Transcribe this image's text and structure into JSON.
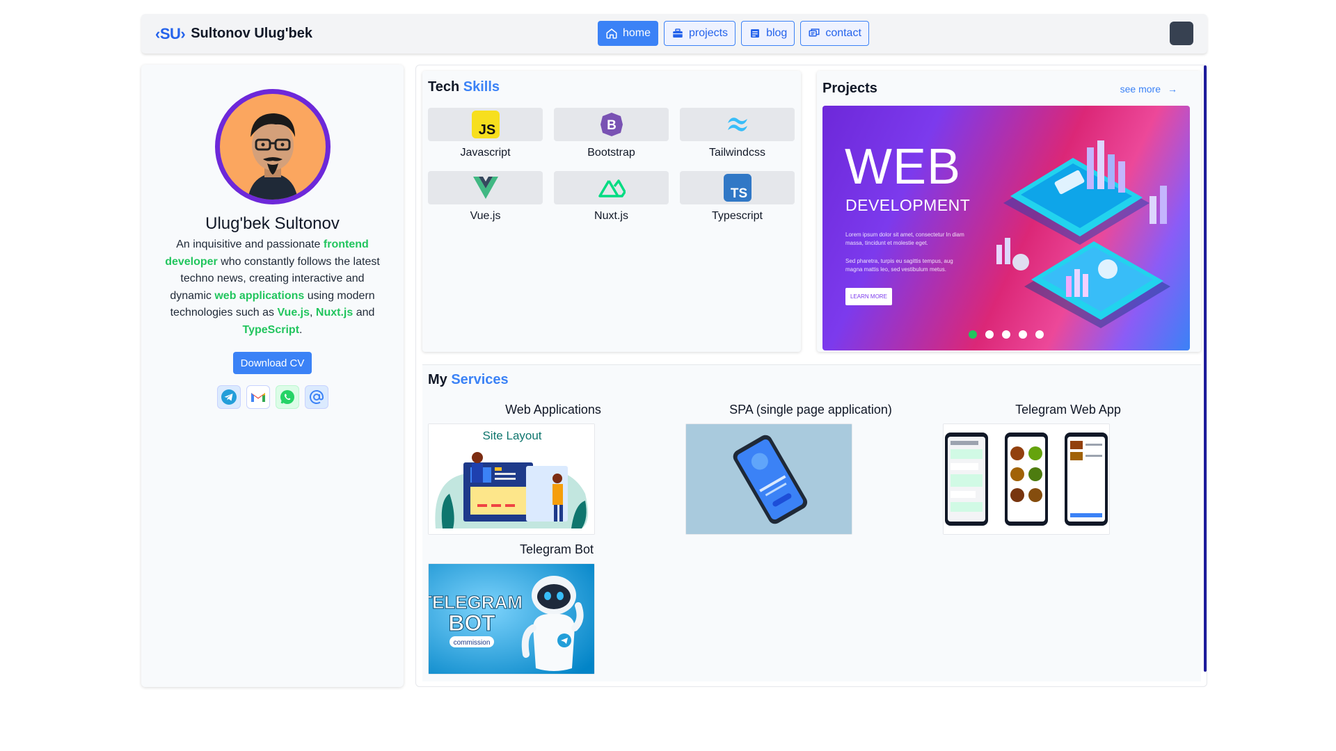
{
  "header": {
    "logo": "‹SU›",
    "brand_name": "Sultonov Ulug'bek",
    "nav": [
      {
        "label": "home",
        "icon": "home-icon",
        "active": true
      },
      {
        "label": "projects",
        "icon": "briefcase-icon",
        "active": false
      },
      {
        "label": "blog",
        "icon": "article-icon",
        "active": false
      },
      {
        "label": "contact",
        "icon": "chat-icon",
        "active": false
      }
    ]
  },
  "profile": {
    "name": "Ulug'bek Sultonov",
    "bio": {
      "t1": "An inquisitive and passionate ",
      "h1": "frontend developer",
      "t2": " who constantly follows the latest techno news, creating interactive and dynamic ",
      "h2": "web applications",
      "t3": " using modern technologies such as ",
      "h3": "Vue.js",
      "t4": ", ",
      "h4": "Nuxt.js",
      "t5": " and ",
      "h5": "TypeScript",
      "t6": "."
    },
    "cv_button": "Download CV",
    "socials": [
      "telegram-icon",
      "gmail-icon",
      "whatsapp-icon",
      "email-at-icon"
    ]
  },
  "skills": {
    "title_a": "Tech ",
    "title_b": "Skills",
    "items": [
      "Javascript",
      "Bootstrap",
      "Tailwindcss",
      "Vue.js",
      "Nuxt.js",
      "Typescript"
    ]
  },
  "projects": {
    "title": "Projects",
    "see_more": "see more",
    "slide": {
      "title": "WEB",
      "subtitle": "DEVELOPMENT",
      "text1": "Lorem ipsum dolor sit amet, consectetur In diam massa, tincidunt et molestie eget.",
      "text2": "Sed pharetra, turpis eu sagittis tempus, aug magna mattis leo, sed vestibulum metus.",
      "button": "LEARN MORE"
    },
    "dots": 5,
    "active_dot": 0
  },
  "services": {
    "title_a": "My ",
    "title_b": "Services",
    "items": [
      {
        "label": "Web Applications",
        "image_text": "Site Layout"
      },
      {
        "label": "SPA (single page application)"
      },
      {
        "label": "Telegram Web App"
      },
      {
        "label": "Telegram Bot",
        "image_text_1": "TELEGRAM",
        "image_text_2": "BOT",
        "image_text_3": "commission"
      }
    ]
  },
  "colors": {
    "accent": "#3b82f6",
    "highlight": "#22c55e",
    "avatar_ring": "#6d28d9"
  }
}
